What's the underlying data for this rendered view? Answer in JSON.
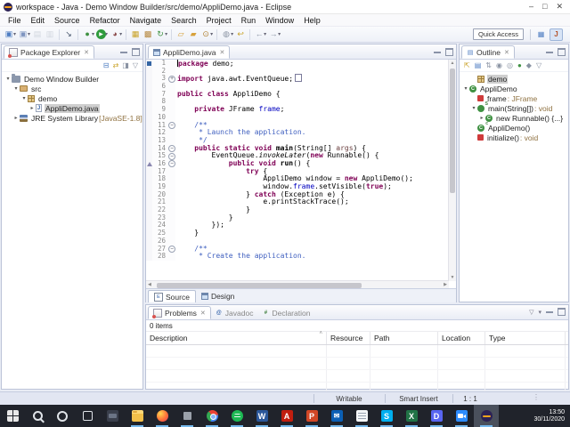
{
  "window": {
    "title": "workspace - Java - Demo Window Builder/src/demo/AppliDemo.java - Eclipse",
    "controls": {
      "minimize": "–",
      "maximize": "□",
      "close": "✕"
    }
  },
  "menubar": [
    "File",
    "Edit",
    "Source",
    "Refactor",
    "Navigate",
    "Search",
    "Project",
    "Run",
    "Window",
    "Help"
  ],
  "toolbar": {
    "quick_access_label": "Quick Access",
    "icons": [
      {
        "name": "new-wizard",
        "glyph": "▣",
        "color": "#4f7ec2",
        "dd": true
      },
      {
        "name": "new-java-class",
        "glyph": "▣",
        "color": "#7f95c0",
        "dd": true
      },
      {
        "name": "save",
        "glyph": "▤",
        "color": "#a8b0bd",
        "disabled": true
      },
      {
        "name": "save-all",
        "glyph": "▥",
        "color": "#a8b0bd",
        "disabled": true
      },
      {
        "sep": true
      },
      {
        "name": "open-element",
        "glyph": "↘",
        "color": "#44546a"
      },
      {
        "sep": true
      },
      {
        "name": "debug",
        "glyph": "●",
        "color": "#3f9142",
        "dd": true
      },
      {
        "name": "run",
        "glyph": "▶",
        "color": "#2e9b3d",
        "dd": true,
        "run": true
      },
      {
        "name": "coverage",
        "glyph": "◕",
        "color": "#8a4a4a",
        "dd": true
      },
      {
        "sep": true
      },
      {
        "name": "new-java-project",
        "glyph": "▦",
        "color": "#c9a227"
      },
      {
        "name": "new-package",
        "glyph": "▩",
        "color": "#b5863c"
      },
      {
        "name": "refresh",
        "glyph": "↻",
        "color": "#3f9142",
        "dd": true
      },
      {
        "sep": true
      },
      {
        "name": "open-task",
        "glyph": "▱",
        "color": "#d7a13b"
      },
      {
        "name": "import",
        "glyph": "▰",
        "color": "#d7a13b"
      },
      {
        "name": "search",
        "glyph": "⊙",
        "color": "#b08030",
        "dd": true
      },
      {
        "sep": true
      },
      {
        "name": "annotation",
        "glyph": "◍",
        "color": "#8a93a3",
        "dd": true
      },
      {
        "name": "last-edit",
        "glyph": "↩",
        "color": "#c9a227"
      },
      {
        "sep": true
      },
      {
        "name": "back",
        "glyph": "←",
        "color": "#8a93a3",
        "dd": true
      },
      {
        "name": "forward",
        "glyph": "→",
        "color": "#8a93a3",
        "dd": true
      }
    ]
  },
  "package_explorer": {
    "title": "Package Explorer",
    "toolbar_icons": [
      {
        "name": "collapse-all",
        "glyph": "⊟",
        "color": "#4f7ec2"
      },
      {
        "name": "link-with-editor",
        "glyph": "⇄",
        "color": "#c9a227"
      },
      {
        "name": "filter",
        "glyph": "◨",
        "color": "#8a93a3"
      },
      {
        "name": "view-menu",
        "glyph": "▽",
        "color": "#8a93a3"
      }
    ],
    "tree": [
      {
        "label": "Demo Window Builder",
        "icon": "project",
        "depth": 0,
        "arrow": "expanded",
        "selected": false
      },
      {
        "label": "src",
        "icon": "source-folder",
        "depth": 1,
        "arrow": "expanded",
        "selected": false
      },
      {
        "label": "demo",
        "icon": "package",
        "depth": 2,
        "arrow": "expanded",
        "selected": false
      },
      {
        "label": "AppliDemo.java",
        "icon": "java-file",
        "depth": 3,
        "arrow": "collapsed",
        "selected": true
      },
      {
        "label": "JRE System Library",
        "suffix": " [JavaSE-1.8]",
        "icon": "library",
        "depth": 1,
        "arrow": "collapsed",
        "selected": false
      }
    ]
  },
  "editor": {
    "tab_label": "AppliDemo.java",
    "lines": [
      {
        "n": "1",
        "fold": "",
        "marker": "cursor",
        "seg": [
          [
            "k",
            "package"
          ],
          [
            "p",
            " demo;"
          ]
        ]
      },
      {
        "n": "2",
        "fold": "",
        "seg": []
      },
      {
        "n": "3",
        "fold": "+",
        "seg": [
          [
            "k",
            "import"
          ],
          [
            "p",
            " java.awt.EventQueue;"
          ],
          [
            "box",
            ""
          ]
        ]
      },
      {
        "n": "6",
        "fold": "",
        "seg": []
      },
      {
        "n": "7",
        "fold": "",
        "seg": [
          [
            "k",
            "public"
          ],
          [
            "p",
            " "
          ],
          [
            "k",
            "class"
          ],
          [
            "p",
            " AppliDemo {"
          ]
        ]
      },
      {
        "n": "8",
        "fold": "",
        "seg": []
      },
      {
        "n": "9",
        "fold": "",
        "seg": [
          [
            "p",
            "    "
          ],
          [
            "k",
            "private"
          ],
          [
            "p",
            " JFrame "
          ],
          [
            "f",
            "frame"
          ],
          [
            "p",
            ";"
          ]
        ]
      },
      {
        "n": "10",
        "fold": "",
        "seg": []
      },
      {
        "n": "11",
        "fold": "-",
        "seg": [
          [
            "c",
            "    /**"
          ]
        ]
      },
      {
        "n": "12",
        "fold": "",
        "seg": [
          [
            "c",
            "     * Launch the application."
          ]
        ]
      },
      {
        "n": "13",
        "fold": "",
        "seg": [
          [
            "c",
            "     */"
          ]
        ]
      },
      {
        "n": "14",
        "fold": "-",
        "seg": [
          [
            "p",
            "    "
          ],
          [
            "k",
            "public"
          ],
          [
            "p",
            " "
          ],
          [
            "k",
            "static"
          ],
          [
            "p",
            " "
          ],
          [
            "k",
            "void"
          ],
          [
            "p",
            " "
          ],
          [
            "m",
            "main"
          ],
          [
            "p",
            "(String[] "
          ],
          [
            "v",
            "args"
          ],
          [
            "p",
            ") {"
          ]
        ]
      },
      {
        "n": "15",
        "fold": "-",
        "seg": [
          [
            "p",
            "        EventQueue."
          ],
          [
            "i",
            "invokeLater"
          ],
          [
            "p",
            "("
          ],
          [
            "k",
            "new"
          ],
          [
            "p",
            " Runnable() {"
          ]
        ]
      },
      {
        "n": "16",
        "fold": "-",
        "marker": "override",
        "seg": [
          [
            "p",
            "            "
          ],
          [
            "k",
            "public"
          ],
          [
            "p",
            " "
          ],
          [
            "k",
            "void"
          ],
          [
            "p",
            " "
          ],
          [
            "m",
            "run"
          ],
          [
            "p",
            "() {"
          ]
        ]
      },
      {
        "n": "17",
        "fold": "",
        "seg": [
          [
            "p",
            "                "
          ],
          [
            "k",
            "try"
          ],
          [
            "p",
            " {"
          ]
        ]
      },
      {
        "n": "18",
        "fold": "",
        "seg": [
          [
            "p",
            "                    AppliDemo window = "
          ],
          [
            "k",
            "new"
          ],
          [
            "p",
            " AppliDemo();"
          ]
        ]
      },
      {
        "n": "19",
        "fold": "",
        "seg": [
          [
            "p",
            "                    window."
          ],
          [
            "f",
            "frame"
          ],
          [
            "p",
            ".setVisible("
          ],
          [
            "k",
            "true"
          ],
          [
            "p",
            ");"
          ]
        ]
      },
      {
        "n": "20",
        "fold": "",
        "seg": [
          [
            "p",
            "                } "
          ],
          [
            "k",
            "catch"
          ],
          [
            "p",
            " (Exception e) {"
          ]
        ]
      },
      {
        "n": "21",
        "fold": "",
        "seg": [
          [
            "p",
            "                    e.printStackTrace();"
          ]
        ]
      },
      {
        "n": "22",
        "fold": "",
        "seg": [
          [
            "p",
            "                }"
          ]
        ]
      },
      {
        "n": "23",
        "fold": "",
        "seg": [
          [
            "p",
            "            }"
          ]
        ]
      },
      {
        "n": "24",
        "fold": "",
        "seg": [
          [
            "p",
            "        });"
          ]
        ]
      },
      {
        "n": "25",
        "fold": "",
        "seg": [
          [
            "p",
            "    }"
          ]
        ]
      },
      {
        "n": "26",
        "fold": "",
        "seg": []
      },
      {
        "n": "27",
        "fold": "-",
        "seg": [
          [
            "c",
            "    /**"
          ]
        ]
      },
      {
        "n": "28",
        "fold": "",
        "seg": [
          [
            "c",
            "     * Create the application."
          ]
        ]
      }
    ],
    "bottom_tabs": [
      {
        "label": "Source",
        "icon": "source",
        "active": true
      },
      {
        "label": "Design",
        "icon": "design",
        "active": false
      }
    ]
  },
  "outline": {
    "title": "Outline",
    "toolbar_icons": [
      {
        "name": "focus",
        "glyph": "⇱",
        "color": "#c9a227"
      },
      {
        "name": "sort",
        "glyph": "▤",
        "color": "#4f7ec2"
      },
      {
        "name": "sort-alpha",
        "glyph": "⇅",
        "color": "#8a93a3"
      },
      {
        "name": "hide-fields",
        "glyph": "◉",
        "color": "#8a93a3"
      },
      {
        "name": "hide-static",
        "glyph": "◎",
        "color": "#8a93a3"
      },
      {
        "name": "hide-non-public",
        "glyph": "●",
        "color": "#3f9142"
      },
      {
        "name": "hide-local-types",
        "glyph": "◆",
        "color": "#8a93a3"
      },
      {
        "name": "view-menu",
        "glyph": "▽",
        "color": "#8a93a3"
      }
    ],
    "tree": [
      {
        "label": "demo",
        "icon": "package",
        "depth": 1,
        "arrow": "",
        "selected": true
      },
      {
        "label": "AppliDemo",
        "icon": "class",
        "depth": 0,
        "arrow": "expanded",
        "selected": false
      },
      {
        "label": "frame",
        "suffix": " : JFrame",
        "icon": "field-private",
        "depth": 1,
        "arrow": "",
        "selected": false
      },
      {
        "label": "main(String[])",
        "suffix": " : void",
        "icon": "method-static",
        "depth": 1,
        "arrow": "expanded",
        "selected": false
      },
      {
        "label": "new Runnable() {...}",
        "icon": "anonymous-class",
        "depth": 2,
        "arrow": "collapsed",
        "selected": false
      },
      {
        "label": "AppliDemo()",
        "icon": "constructor",
        "depth": 1,
        "arrow": "",
        "selected": false
      },
      {
        "label": "initialize()",
        "suffix": " : void",
        "icon": "method-private",
        "depth": 1,
        "arrow": "",
        "selected": false
      }
    ]
  },
  "problems": {
    "tabs": [
      {
        "label": "Problems",
        "icon": "problems",
        "active": true
      },
      {
        "label": "Javadoc",
        "icon": "javadoc",
        "active": false
      },
      {
        "label": "Declaration",
        "icon": "decl",
        "active": false
      }
    ],
    "summary": "0 items",
    "columns": [
      "Description",
      "Resource",
      "Path",
      "Location",
      "Type"
    ]
  },
  "statusbar": {
    "writable": "Writable",
    "insert_mode": "Smart Insert",
    "cursor_position": "1 : 1"
  },
  "taskbar": {
    "time": "13:50",
    "date": "30/11/2020",
    "icons": [
      {
        "name": "start",
        "kind": "start"
      },
      {
        "name": "search",
        "kind": "search"
      },
      {
        "name": "cortana",
        "kind": "cortana"
      },
      {
        "name": "task-view",
        "kind": "task-view"
      },
      {
        "name": "terminal",
        "kind": "terminal"
      },
      {
        "name": "file-explorer",
        "kind": "file-explorer",
        "running": true
      },
      {
        "name": "firefox",
        "kind": "firefox",
        "running": true
      },
      {
        "name": "photos",
        "kind": "photos",
        "running": true
      },
      {
        "name": "chrome",
        "kind": "chrome",
        "running": true
      },
      {
        "name": "spotify",
        "kind": "spotify",
        "running": true
      },
      {
        "name": "word",
        "kind": "letter",
        "glyph": "W",
        "color": "#2b579a",
        "running": true
      },
      {
        "name": "acrobat",
        "kind": "letter",
        "glyph": "A",
        "color": "#c11e0f",
        "running": true
      },
      {
        "name": "powerpoint",
        "kind": "letter",
        "glyph": "P",
        "color": "#d24726",
        "running": true
      },
      {
        "name": "mail",
        "kind": "mail",
        "glyph": "✉",
        "running": true
      },
      {
        "name": "notes",
        "kind": "notes",
        "running": true
      },
      {
        "name": "skype",
        "kind": "letter",
        "glyph": "S",
        "color": "#00aff0",
        "running": true
      },
      {
        "name": "excel",
        "kind": "letter",
        "glyph": "X",
        "color": "#217346",
        "running": true
      },
      {
        "name": "discord",
        "kind": "letter",
        "glyph": "D",
        "color": "#5865f2",
        "running": true
      },
      {
        "name": "zoom",
        "kind": "zoom",
        "running": true
      },
      {
        "name": "eclipse",
        "kind": "eclipse",
        "active": true,
        "running": true
      }
    ]
  }
}
